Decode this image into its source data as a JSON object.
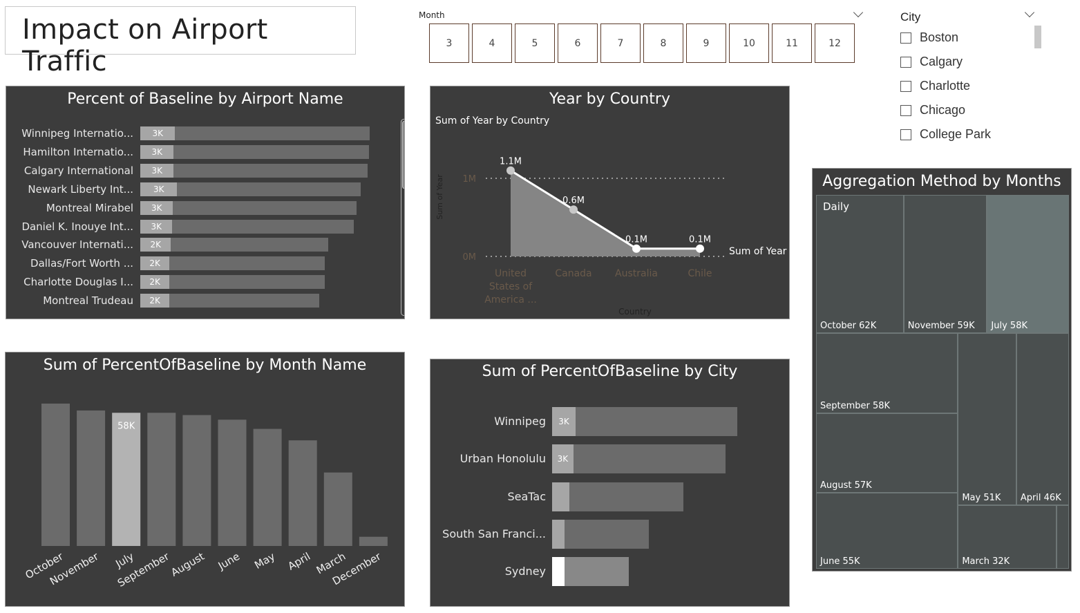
{
  "title": "Impact on Airport Traffic",
  "month_slicer": {
    "label": "Month",
    "options": [
      "3",
      "4",
      "5",
      "6",
      "7",
      "8",
      "9",
      "10",
      "11",
      "12"
    ]
  },
  "city_slicer": {
    "label": "City",
    "options": [
      "Boston",
      "Calgary",
      "Charlotte",
      "Chicago",
      "College Park"
    ]
  },
  "colors": {
    "panel_bg": "#3c3c3c",
    "bar": "#6b6b6b",
    "highlight": "#a6a6a6",
    "treemap": "#4a4f4f",
    "treemap_hl": "#697575"
  },
  "chart_data": [
    {
      "id": "airport",
      "type": "bar",
      "title": "Percent of Baseline by Airport Name",
      "categories": [
        "Winnipeg Internatio...",
        "Hamilton Internatio...",
        "Calgary International",
        "Newark Liberty Int...",
        "Montreal Mirabel",
        "Daniel K. Inouye Int...",
        "Vancouver Internati...",
        "Dallas/Fort Worth ...",
        "Charlotte Douglas I...",
        "Montreal Trudeau"
      ],
      "values": [
        3.29,
        3.28,
        3.26,
        3.16,
        3.1,
        3.06,
        2.7,
        2.65,
        2.65,
        2.57
      ],
      "highlight_values": [
        0.5,
        0.48,
        0.48,
        0.53,
        0.47,
        0.46,
        0.44,
        0.42,
        0.42,
        0.42
      ],
      "highlight_labels": [
        "3K",
        "3K",
        "3K",
        "3K",
        "3K",
        "3K",
        "2K",
        "2K",
        "2K",
        "2K"
      ]
    },
    {
      "id": "country",
      "type": "area",
      "title": "Year by Country",
      "subtitle": "Sum of Year by Country",
      "xlabel": "Country",
      "ylabel": "Sum of Year",
      "legend": "Sum of Year",
      "categories": [
        "United States of America ...",
        "Canada",
        "Australia",
        "Chile"
      ],
      "x_label_lines": [
        [
          "United",
          "States of",
          "America ..."
        ],
        [
          "Canada"
        ],
        [
          "Australia"
        ],
        [
          "Chile"
        ]
      ],
      "values": [
        1.1,
        0.6,
        0.1,
        0.1
      ],
      "value_labels": [
        "1.1M",
        "0.6M",
        "0.1M",
        "0.1M"
      ],
      "y_ticks": [
        "0M",
        "1M"
      ],
      "ylim": [
        0,
        1.2
      ]
    },
    {
      "id": "month",
      "type": "bar",
      "title": "Sum of PercentOfBaseline by Month Name",
      "categories": [
        "October",
        "November",
        "July",
        "September",
        "August",
        "June",
        "May",
        "April",
        "March",
        "December"
      ],
      "values": [
        62,
        59,
        58,
        58,
        57,
        55,
        51,
        46,
        32,
        4
      ],
      "highlight_index": 2,
      "highlight_label": "58K"
    },
    {
      "id": "city",
      "type": "bar",
      "title": "Sum of PercentOfBaseline by City",
      "categories": [
        "Winnipeg",
        "Urban Honolulu",
        "SeaTac",
        "South San Franci...",
        "Sydney"
      ],
      "values": [
        3.3,
        3.09,
        2.34,
        1.73,
        1.37
      ],
      "highlight_values": [
        0.42,
        0.38,
        0.31,
        0.22,
        0.22
      ],
      "highlight_labels": [
        "3K",
        "3K",
        "",
        "",
        ""
      ]
    },
    {
      "id": "treemap",
      "type": "treemap",
      "title": "Aggregation Method by Months",
      "group_label": "Daily",
      "items": [
        {
          "name": "October",
          "value": 62,
          "label": "October 62K"
        },
        {
          "name": "November",
          "value": 59,
          "label": "November 59K"
        },
        {
          "name": "July",
          "value": 58,
          "label": "July 58K",
          "highlight": true
        },
        {
          "name": "September",
          "value": 58,
          "label": "September 58K"
        },
        {
          "name": "August",
          "value": 57,
          "label": "August 57K"
        },
        {
          "name": "June",
          "value": 55,
          "label": "June 55K"
        },
        {
          "name": "May",
          "value": 51,
          "label": "May 51K"
        },
        {
          "name": "April",
          "value": 46,
          "label": "April 46K"
        },
        {
          "name": "March",
          "value": 32,
          "label": "March 32K"
        },
        {
          "name": "December",
          "value": 4,
          "label": ""
        }
      ]
    }
  ]
}
